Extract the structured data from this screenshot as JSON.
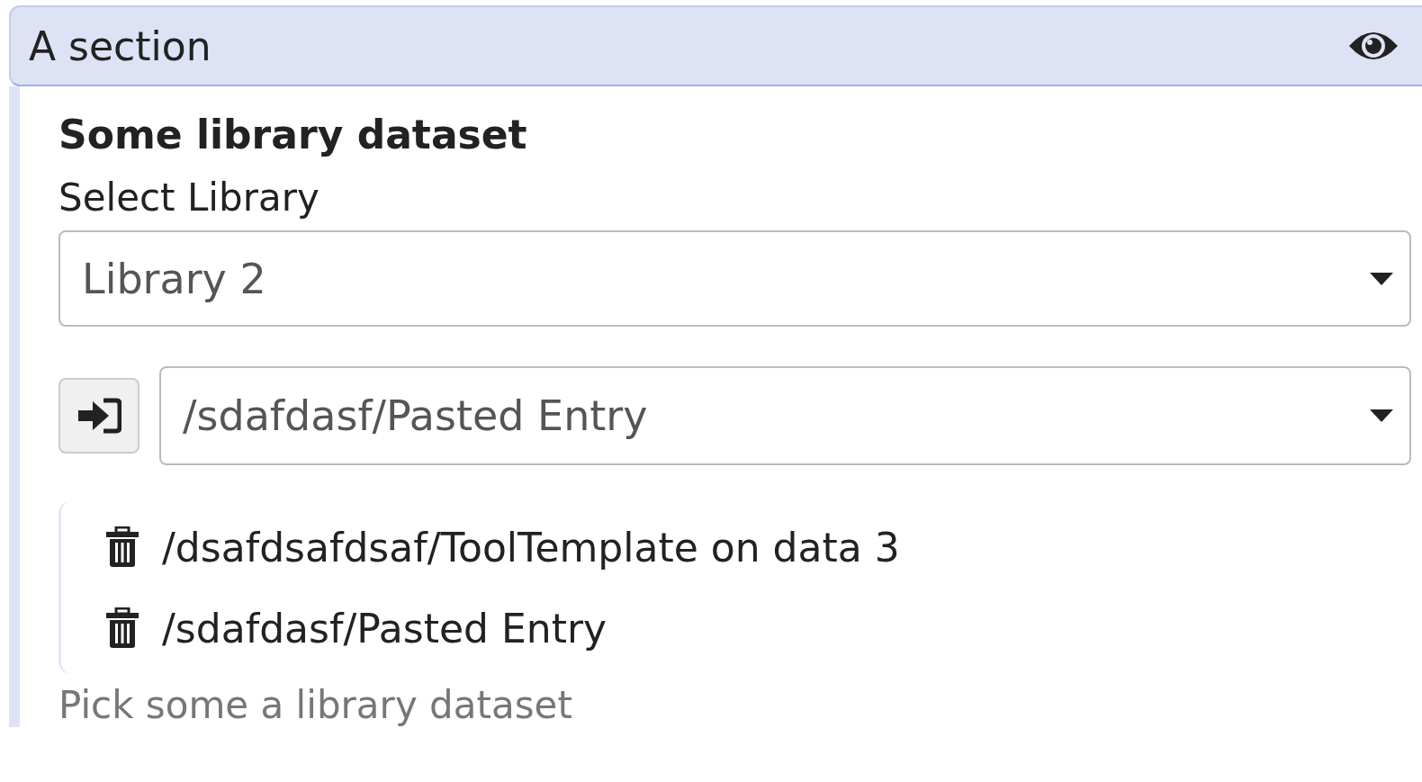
{
  "section": {
    "title": "A section"
  },
  "field": {
    "label": "Some library dataset",
    "library_select": {
      "label": "Select Library",
      "value": "Library 2"
    },
    "dataset_select": {
      "value": "/sdafdasf/Pasted Entry"
    },
    "selected_items": [
      {
        "path": "/dsafdsafdsaf/ToolTemplate on data 3"
      },
      {
        "path": "/sdafdasf/Pasted Entry"
      }
    ],
    "help": "Pick some a library dataset"
  }
}
